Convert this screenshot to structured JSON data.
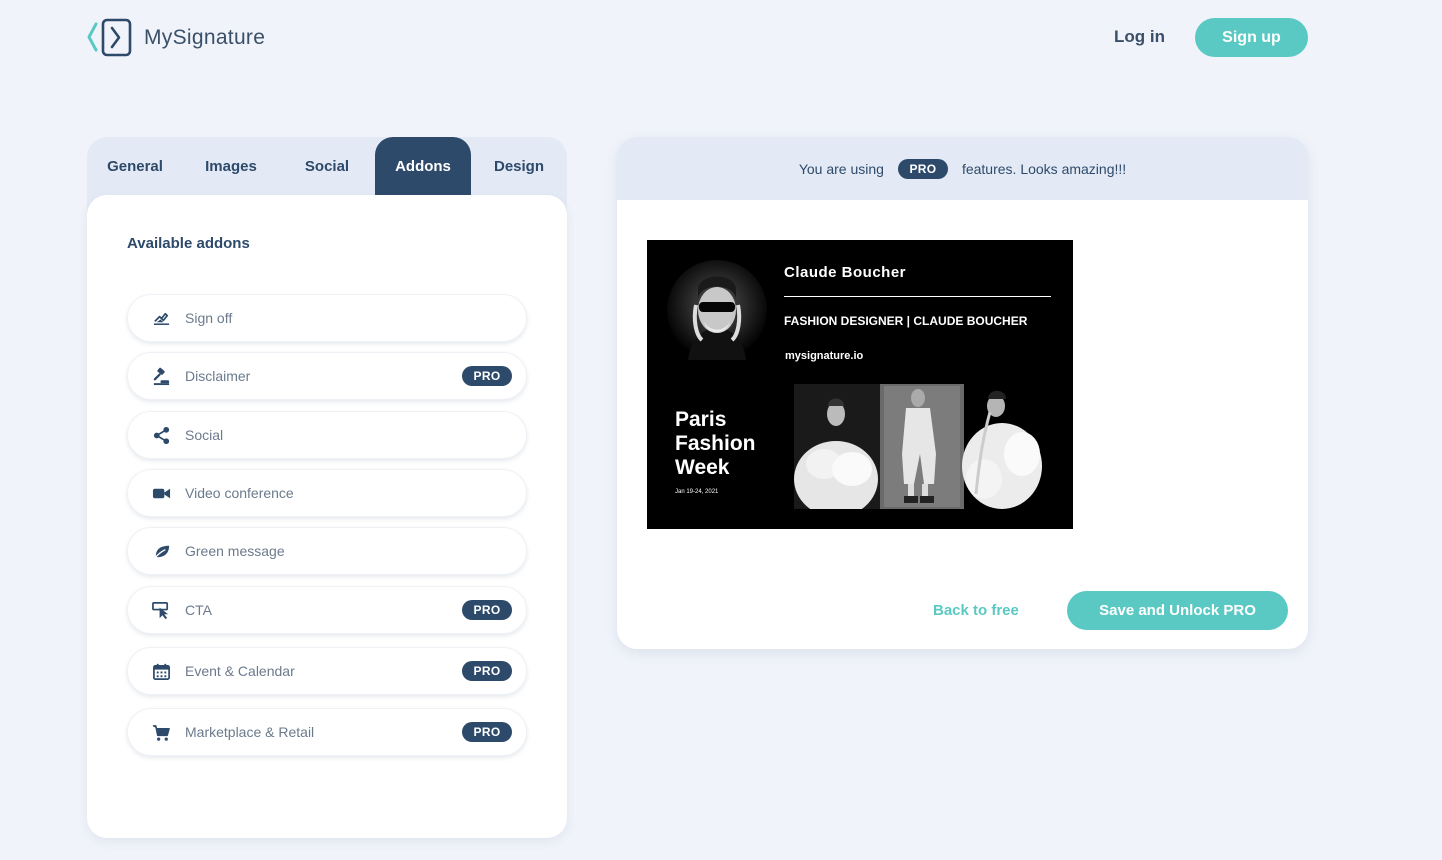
{
  "header": {
    "brand": "MySignature",
    "login_label": "Log in",
    "signup_label": "Sign up"
  },
  "tabs": [
    {
      "label": "General",
      "active": false
    },
    {
      "label": "Images",
      "active": false
    },
    {
      "label": "Social",
      "active": false
    },
    {
      "label": "Addons",
      "active": true
    },
    {
      "label": "Design",
      "active": false
    }
  ],
  "addons": {
    "title": "Available addons",
    "pro_badge": "PRO",
    "items": [
      {
        "label": "Sign off",
        "icon": "signature-icon",
        "pro": false
      },
      {
        "label": "Disclaimer",
        "icon": "gavel-icon",
        "pro": true
      },
      {
        "label": "Social",
        "icon": "share-icon",
        "pro": false
      },
      {
        "label": "Video conference",
        "icon": "video-camera-icon",
        "pro": false
      },
      {
        "label": "Green message",
        "icon": "leaf-icon",
        "pro": false
      },
      {
        "label": "CTA",
        "icon": "cursor-click-icon",
        "pro": true
      },
      {
        "label": "Event & Calendar",
        "icon": "calendar-icon",
        "pro": true
      },
      {
        "label": "Marketplace & Retail",
        "icon": "cart-icon",
        "pro": true
      }
    ]
  },
  "preview": {
    "banner_prefix": "You are using",
    "banner_badge": "PRO",
    "banner_suffix": "features. Looks amazing!!!",
    "signature": {
      "name": "Claude Boucher",
      "job": "FASHION DESIGNER | CLAUDE BOUCHER",
      "website": "mysignature.io",
      "event_title": "Paris Fashion Week",
      "event_date": "Jan 19-24, 2021"
    },
    "back_label": "Back to free",
    "save_label": "Save and Unlock PRO"
  },
  "colors": {
    "background": "#f0f3fa",
    "navy": "#2e4a6b",
    "teal": "#5bc9c3",
    "panel_tint": "#e3eaf5"
  }
}
